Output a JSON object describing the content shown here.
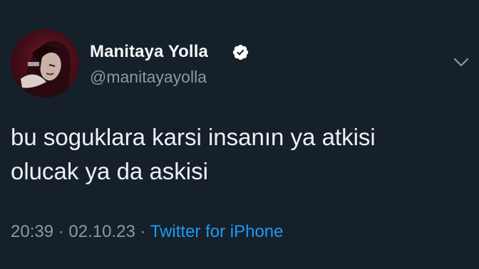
{
  "tweet": {
    "author": {
      "display_name": "Manitaya Yolla",
      "handle": "@manitayayolla",
      "verified": true,
      "avatar_icon": "profile-photo"
    },
    "text_lines": [
      "bu soguklara karsi insanın ya atkisi",
      "olucak ya da askisi"
    ],
    "time": "20:39",
    "separator": "·",
    "date": "02.10.23",
    "source": "Twitter for iPhone"
  },
  "colors": {
    "background": "#15202b",
    "text": "#eef1f3",
    "secondary_text": "#8b98a5",
    "link": "#1d9bf0",
    "verified_badge": "#ffffff"
  },
  "icons": {
    "verified": "verified-badge-icon",
    "menu": "chevron-down-icon"
  }
}
